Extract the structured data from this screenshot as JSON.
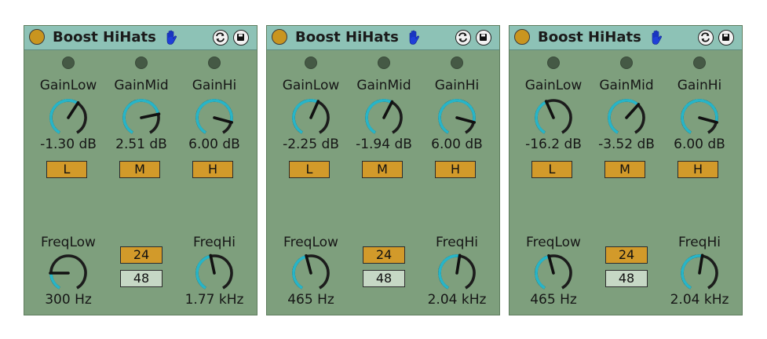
{
  "common": {
    "title": "Boost HiHats",
    "labels": {
      "gain_low": "GainLow",
      "gain_mid": "GainMid",
      "gain_hi": "GainHi",
      "freq_low": "FreqLow",
      "freq_hi": "FreqHi"
    },
    "buttons": {
      "low": "L",
      "mid": "M",
      "high": "H",
      "slope_24": "24",
      "slope_48": "48"
    },
    "icons": {
      "power": "power-toggle-icon",
      "hand": "hand-icon",
      "hot_swap": "hot-swap-icon",
      "save": "save-preset-icon"
    },
    "colors": {
      "panel": "#7e9f7d",
      "titlebar": "#8dc2b6",
      "knob_ring": "#27b5c8",
      "button_on": "#d29a2a"
    }
  },
  "panels": [
    {
      "gain_low": {
        "value": "-1.30 dB",
        "level": 0.61
      },
      "gain_mid": {
        "value": "2.51 dB",
        "level": 0.76
      },
      "gain_hi": {
        "value": "6.00 dB",
        "level": 0.85
      },
      "freq_low": {
        "value": "300 Hz",
        "level": 0.2
      },
      "freq_hi": {
        "value": "1.77 kHz",
        "level": 0.46
      }
    },
    {
      "gain_low": {
        "value": "-2.25 dB",
        "level": 0.58
      },
      "gain_mid": {
        "value": "-1.94 dB",
        "level": 0.59
      },
      "gain_hi": {
        "value": "6.00 dB",
        "level": 0.85
      },
      "freq_low": {
        "value": "465 Hz",
        "level": 0.45
      },
      "freq_hi": {
        "value": "2.04 kHz",
        "level": 0.53
      }
    },
    {
      "gain_low": {
        "value": "-16.2 dB",
        "level": 0.42
      },
      "gain_mid": {
        "value": "-3.52 dB",
        "level": 0.64
      },
      "gain_hi": {
        "value": "6.00 dB",
        "level": 0.85
      },
      "freq_low": {
        "value": "465 Hz",
        "level": 0.45
      },
      "freq_hi": {
        "value": "2.04 kHz",
        "level": 0.53
      }
    }
  ]
}
